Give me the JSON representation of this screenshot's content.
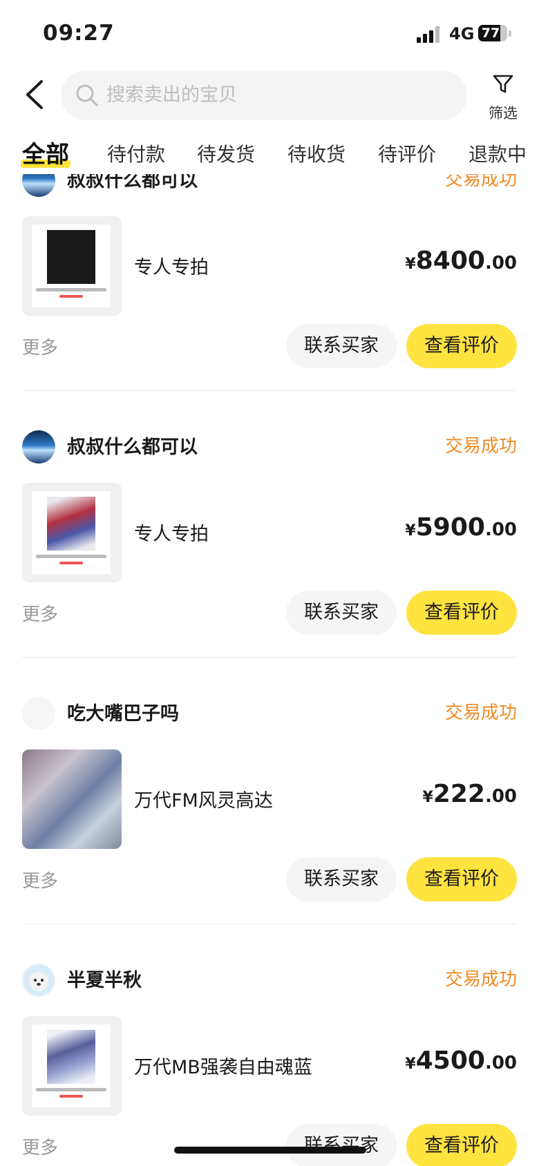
{
  "status_bar": {
    "time": "09:27",
    "network": "4G",
    "battery": "77",
    "battery_level": 0.77
  },
  "search": {
    "placeholder": "搜索卖出的宝贝"
  },
  "filter": {
    "label": "筛选"
  },
  "tabs": [
    {
      "label": "全部",
      "active": true
    },
    {
      "label": "待付款"
    },
    {
      "label": "待发货"
    },
    {
      "label": "待收货"
    },
    {
      "label": "待评价"
    },
    {
      "label": "退款中"
    }
  ],
  "orders": [
    {
      "buyer": "叔叔什么都可以",
      "status": "交易成功",
      "title": "专人专拍",
      "price_yen": "¥",
      "price_int": "8400",
      "price_dec": ".00",
      "more": "更多",
      "contact": "联系买家",
      "review": "查看评价"
    },
    {
      "buyer": "叔叔什么都可以",
      "status": "交易成功",
      "title": "专人专拍",
      "price_yen": "¥",
      "price_int": "5900",
      "price_dec": ".00",
      "more": "更多",
      "contact": "联系买家",
      "review": "查看评价"
    },
    {
      "buyer": "吃大嘴巴子吗",
      "status": "交易成功",
      "title": "万代FM风灵高达",
      "price_yen": "¥",
      "price_int": "222",
      "price_dec": ".00",
      "more": "更多",
      "contact": "联系买家",
      "review": "查看评价"
    },
    {
      "buyer": "半夏半秋",
      "status": "交易成功",
      "title": "万代MB强袭自由魂蓝",
      "price_yen": "¥",
      "price_int": "4500",
      "price_dec": ".00",
      "more": "更多",
      "contact": "联系买家",
      "review": "查看评价"
    }
  ],
  "colors": {
    "accent_yellow": "#ffe33f",
    "status_orange": "#ef8a22",
    "muted_text": "#9a9a9a"
  }
}
